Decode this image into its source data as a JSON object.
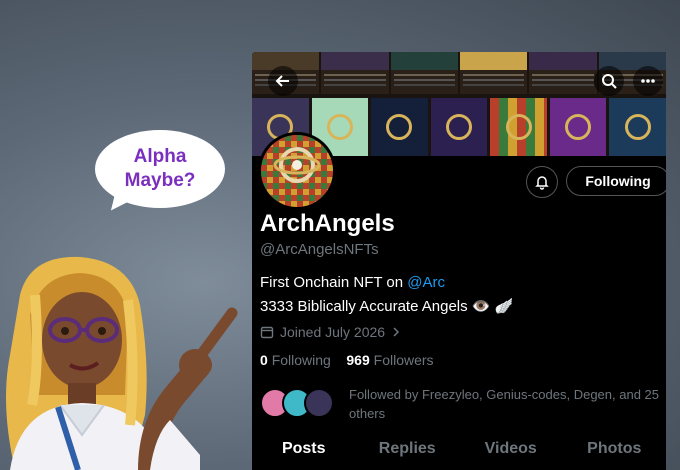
{
  "bubble": {
    "line1": "Alpha",
    "line2": "Maybe?"
  },
  "profile": {
    "name": "ArchAngels",
    "handle": "@ArcAngelsNFTs",
    "bio_prefix": "First Onchain NFT on ",
    "bio_mention": "@Arc",
    "bio_line2": "3333 Biblically Accurate Angels 👁️ 🪽",
    "joined": "Joined July 2026",
    "following_count": "0",
    "following_label": "Following",
    "followers_count": "969",
    "followers_label": "Followers",
    "followed_by": "Followed by Freezyleo, Genius-codes, Degen, and 25 others"
  },
  "actions": {
    "follow_label": "Following"
  },
  "tabs": [
    {
      "label": "Posts"
    },
    {
      "label": "Replies"
    },
    {
      "label": "Videos"
    },
    {
      "label": "Photos"
    }
  ],
  "colors": {
    "accent": "#1d9bf0",
    "bubble_text": "#7b2fbf",
    "muted": "#6e767d"
  },
  "icons": {
    "back": "arrow-left-icon",
    "search": "search-icon",
    "more": "more-icon",
    "bell": "bell-icon",
    "calendar": "calendar-icon",
    "chevron": "chevron-right-icon"
  }
}
